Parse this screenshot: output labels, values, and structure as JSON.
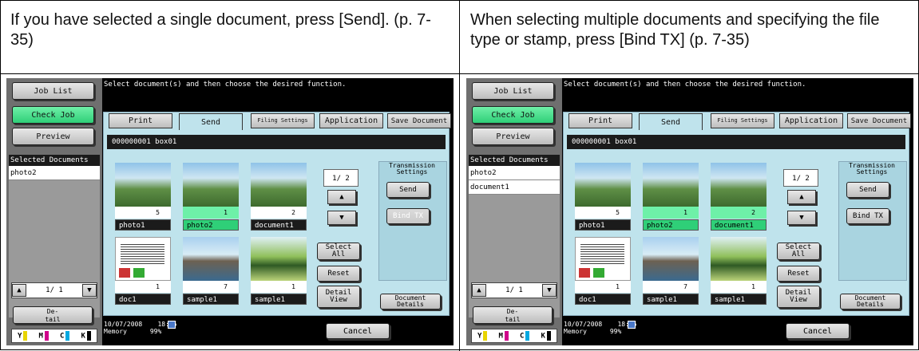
{
  "captions": {
    "left": "If you have selected a single document, press [Send]. (p. 7-35)",
    "right": "When selecting multiple documents and specifying the file type or stamp, press [Bind TX] (p. 7-35)"
  },
  "screen": {
    "left_buttons": [
      "Job List",
      "Check Job",
      "Preview"
    ],
    "message": "Select document(s) and then choose the desired function.",
    "tabs": [
      "Print",
      "Send",
      "Filing Settings",
      "Application",
      "Save Document"
    ],
    "box_label": "000000001  box01",
    "selected_title": "Selected Documents",
    "page_counter": "1/  2",
    "left_pager": "1/  1",
    "detail_label": "De-\ntail",
    "transmission_title": "Transmission Settings",
    "send_label": "Send",
    "bind_label": "Bind TX",
    "select_all": "Select All",
    "reset": "Reset",
    "detail_view": "Detail View",
    "document_details": "Document Details",
    "date": "10/07/2008",
    "time": "18:15",
    "memory_label": "Memory",
    "memory_value": "99%",
    "cancel": "Cancel",
    "ink": [
      "Y",
      "M",
      "C",
      "K"
    ]
  },
  "documents": [
    {
      "name": "photo1",
      "count": "5"
    },
    {
      "name": "photo2",
      "count": "1"
    },
    {
      "name": "document1",
      "count": "2"
    },
    {
      "name": "doc1",
      "count": "1"
    },
    {
      "name": "sample1",
      "count": "7"
    },
    {
      "name": "sample1",
      "count": "1"
    }
  ],
  "left_screen": {
    "selected": [
      "photo2"
    ]
  },
  "right_screen": {
    "selected": [
      "photo2",
      "document1"
    ]
  }
}
